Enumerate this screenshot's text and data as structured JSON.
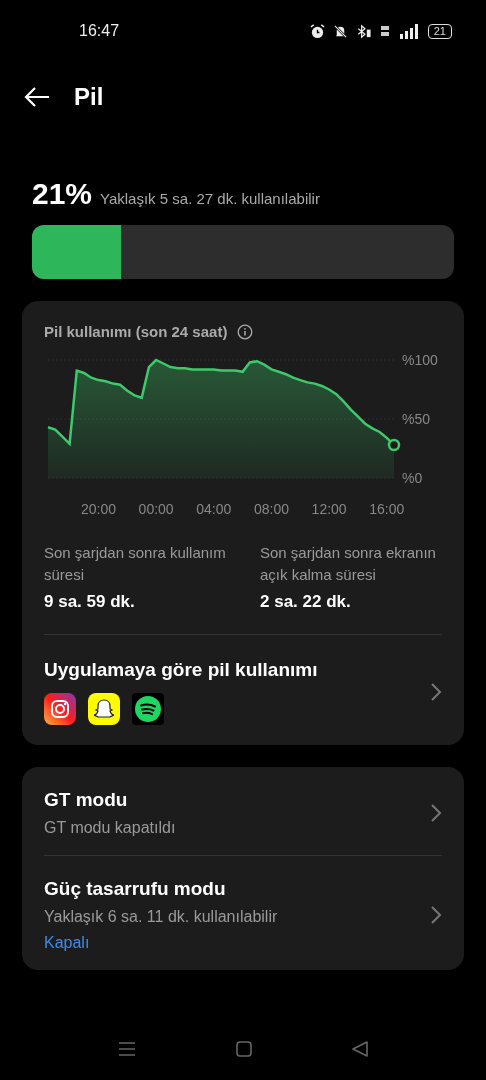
{
  "status_bar": {
    "time": "16:47",
    "battery": "21"
  },
  "header": {
    "title": "Pil"
  },
  "battery": {
    "percent": "21%",
    "estimate": "Yaklaşık 5 sa. 27 dk. kullanılabilir",
    "level": 0.21
  },
  "usage_card": {
    "title": "Pil kullanımı (son 24 saat)",
    "chart_data": {
      "type": "area",
      "categories": [
        null,
        null,
        null,
        null,
        null,
        null,
        null,
        "20:00",
        null,
        null,
        null,
        null,
        null,
        null,
        null,
        "00:00",
        null,
        null,
        null,
        null,
        null,
        null,
        null,
        "04:00",
        null,
        null,
        null,
        null,
        null,
        null,
        null,
        "08:00",
        null,
        null,
        null,
        null,
        null,
        null,
        null,
        "12:00",
        null,
        null,
        null,
        null,
        null,
        null,
        null,
        "16:00",
        null
      ],
      "series": [
        {
          "color": "#3ec96a",
          "values": [
            43,
            41,
            35,
            29,
            91,
            89,
            85,
            83,
            82,
            80,
            79,
            74,
            70,
            68,
            94,
            100,
            97,
            94,
            93,
            93,
            92,
            92,
            92,
            92,
            91,
            91,
            91,
            90,
            98,
            99,
            96,
            92,
            90,
            88,
            85,
            83,
            81,
            80,
            78,
            75,
            71,
            65,
            58,
            52,
            46,
            42,
            39,
            34,
            28
          ]
        }
      ],
      "ylim": [
        0,
        100
      ],
      "yticks": [
        {
          "value": 100,
          "label": "%100"
        },
        {
          "value": 50,
          "label": "%50"
        },
        {
          "value": 0,
          "label": "%0"
        }
      ]
    },
    "stats": [
      {
        "label": "Son şarjdan sonra kullanım süresi",
        "value": "9 sa. 59 dk."
      },
      {
        "label": "Son şarjdan sonra ekranın açık kalma süresi",
        "value": "2 sa. 22 dk."
      }
    ],
    "app_usage": {
      "title": "Uygulamaya göre pil kullanımı",
      "apps": [
        {
          "kind": "instagram"
        },
        {
          "kind": "snapchat"
        },
        {
          "kind": "spotify"
        }
      ]
    }
  },
  "modes": [
    {
      "title": "GT modu",
      "subtitle": "GT modu kapatıldı"
    },
    {
      "title": "Güç tasarrufu modu",
      "subtitle": "Yaklaşık 6 sa. 11 dk. kullanılabilir",
      "status": "Kapalı"
    }
  ]
}
